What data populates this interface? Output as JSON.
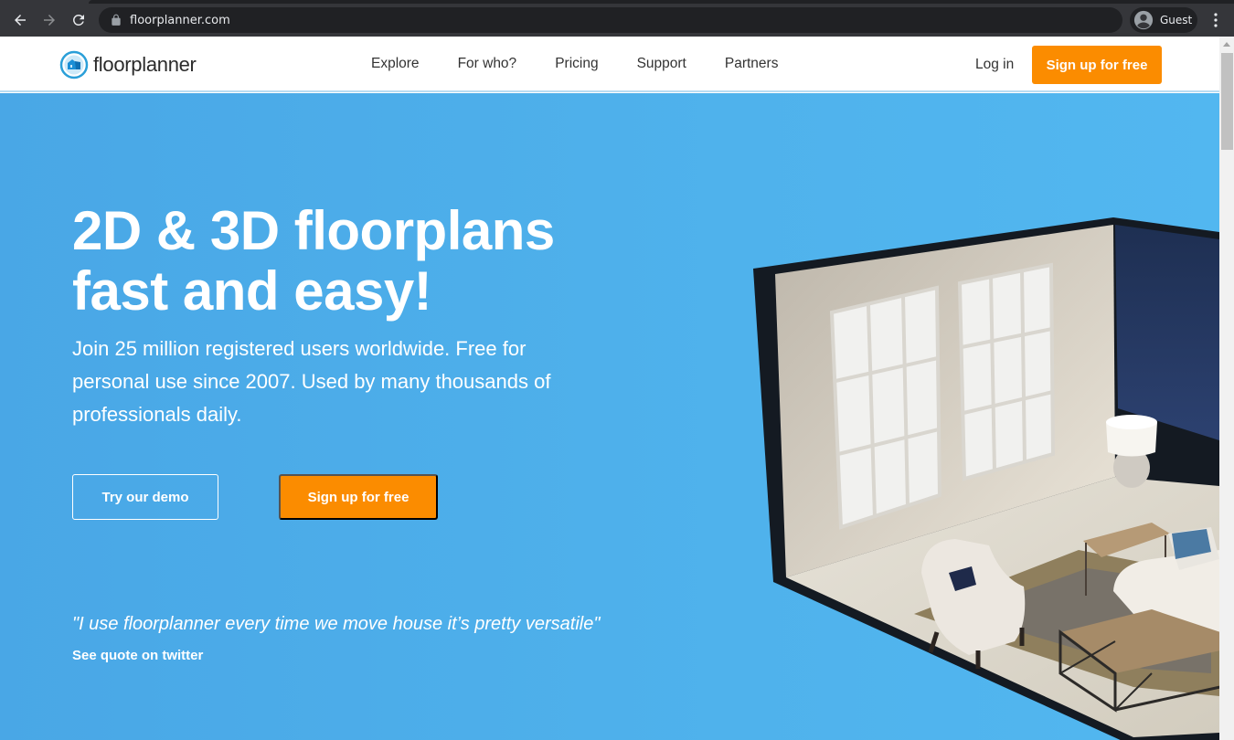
{
  "browser": {
    "url": "floorplanner.com",
    "profile_name": "Guest",
    "icons": {
      "back": "arrow-left-icon",
      "forward": "arrow-right-icon",
      "reload": "reload-icon",
      "lock": "lock-icon",
      "profile": "account-circle-icon",
      "menu": "kebab-menu-icon"
    }
  },
  "header": {
    "logo_text": "floorplanner",
    "nav": [
      {
        "label": "Explore"
      },
      {
        "label": "For who?"
      },
      {
        "label": "Pricing"
      },
      {
        "label": "Support"
      },
      {
        "label": "Partners"
      }
    ],
    "login_label": "Log in",
    "signup_label": "Sign up for free"
  },
  "hero": {
    "headline_line1": "2D & 3D floorplans",
    "headline_line2": "fast and easy!",
    "subtitle": "Join 25 million registered users worldwide. Free for personal use since 2007. Used by many thousands of professionals daily.",
    "demo_label": "Try our demo",
    "signup_label": "Sign up for free",
    "quote": "\"I use floorplanner every time we move house it’s pretty versatile\"",
    "quote_link": "See quote on twitter",
    "image_alt": "3D rendered living room with windows, armchair, sofa, lamp and coffee table"
  },
  "colors": {
    "accent_orange": "#fb8c00",
    "hero_blue": "#4fb2ec",
    "logo_blue": "#2a9fd8"
  }
}
